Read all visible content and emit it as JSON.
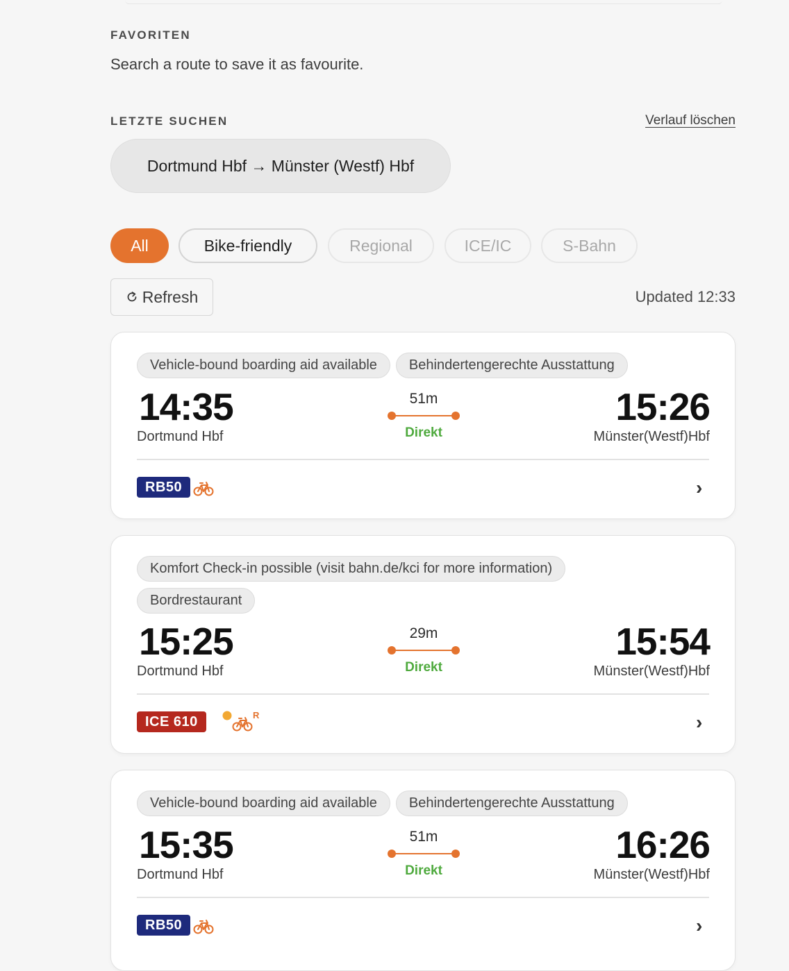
{
  "favorites": {
    "label": "FAVORITEN",
    "empty_text": "Search a route to save it as favourite."
  },
  "recent": {
    "label": "LETZTE SUCHEN",
    "clear_label": "Verlauf löschen",
    "items": [
      {
        "label": "Dortmund Hbf → Münster (Westf) Hbf"
      }
    ]
  },
  "filters": [
    {
      "label": "All",
      "state": "active"
    },
    {
      "label": "Bike-friendly",
      "state": "outlined"
    },
    {
      "label": "Regional",
      "state": "disabled"
    },
    {
      "label": "ICE/IC",
      "state": "disabled"
    },
    {
      "label": "S-Bahn",
      "state": "disabled"
    }
  ],
  "toolbar": {
    "refresh_icon": "refresh-icon",
    "refresh_label": "Refresh",
    "updated_text": "Updated 12:33"
  },
  "colors": {
    "accent": "#e4732e",
    "direkt": "#4faa3e",
    "rb_badge": "#1e2a7c",
    "ice_badge": "#b5281e",
    "bike_icon": "#e4732e"
  },
  "connections": [
    {
      "tags": [
        [
          "Vehicle-bound boarding aid available",
          "Behindertengerechte Ausstattung"
        ]
      ],
      "departure_time": "14:35",
      "departure_station": "Dortmund Hbf",
      "duration": "51m",
      "transfer": "Direkt",
      "arrival_time": "15:26",
      "arrival_station": "Münster(Westf)Hbf",
      "train": "RB50",
      "train_type": "regional",
      "bike_icon": "bicycle-icon",
      "bike_reservation": false
    },
    {
      "tags": [
        [
          "Komfort Check-in possible (visit bahn.de/kci for more information)"
        ],
        [
          "Bordrestaurant"
        ]
      ],
      "departure_time": "15:25",
      "departure_station": "Dortmund Hbf",
      "duration": "29m",
      "transfer": "Direkt",
      "arrival_time": "15:54",
      "arrival_station": "Münster(Westf)Hbf",
      "train": "ICE 610",
      "train_type": "ice",
      "bike_icon": "bicycle-icon",
      "bike_reservation": true,
      "bike_reservation_mark": "R"
    },
    {
      "tags": [
        [
          "Vehicle-bound boarding aid available",
          "Behindertengerechte Ausstattung"
        ]
      ],
      "departure_time": "15:35",
      "departure_station": "Dortmund Hbf",
      "duration": "51m",
      "transfer": "Direkt",
      "arrival_time": "16:26",
      "arrival_station": "Münster(Westf)Hbf",
      "train": "RB50",
      "train_type": "regional",
      "bike_icon": "bicycle-icon",
      "bike_reservation": false
    }
  ]
}
